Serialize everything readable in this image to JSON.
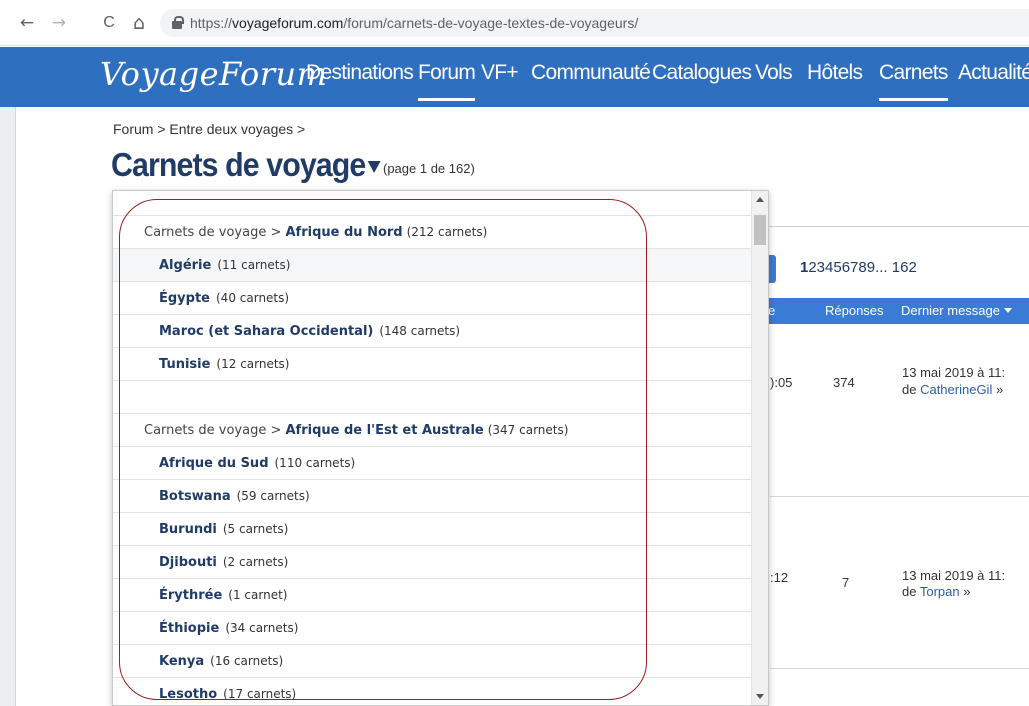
{
  "browser": {
    "back": "←",
    "forward": "→",
    "reload": "C",
    "home": "⌂",
    "url_prefix": "https://",
    "url_domain": "voyageforum.com",
    "url_path": "/forum/carnets-de-voyage-textes-de-voyageurs/"
  },
  "header": {
    "logo": "VoyageForum",
    "nav": [
      "Destinations",
      "Forum",
      "VF+",
      "Communauté",
      "Catalogues",
      "Vols",
      "Hôtels",
      "Carnets",
      "Actualité"
    ],
    "accent": "#2f6fc0"
  },
  "page": {
    "breadcrumb": "Forum > Entre deux voyages >",
    "title": "Carnets de voyage",
    "subtitle": "(page 1 de 162)"
  },
  "pager": {
    "current": "1",
    "pages": "23456789",
    "ellipsis": "...",
    "last": "162"
  },
  "table": {
    "col_fragment": "e",
    "col_reponses": "Réponses",
    "col_dernier": "Dernier message",
    "rows": [
      {
        "time_fragment": "):05",
        "reponses": "374",
        "date": "13 mai 2019 à 11:",
        "by_prefix": "de ",
        "author": "CatherineGil",
        "arrow": " »"
      },
      {
        "time_fragment": ":12",
        "reponses": "7",
        "date": "13 mai 2019 à 11:",
        "by_prefix": "de ",
        "author": "Torpan",
        "arrow": " »"
      }
    ]
  },
  "dropdown": {
    "groups": [
      {
        "prefix": "Carnets de voyage > ",
        "region": "Afrique du Nord",
        "count": "(212 carnets)",
        "items": [
          {
            "name": "Algérie",
            "count": "(11 carnets)"
          },
          {
            "name": "Égypte",
            "count": "(40 carnets)"
          },
          {
            "name": "Maroc (et Sahara Occidental)",
            "count": "(148 carnets)"
          },
          {
            "name": "Tunisie",
            "count": "(12 carnets)"
          }
        ]
      },
      {
        "prefix": "Carnets de voyage > ",
        "region": "Afrique de l'Est et Australe",
        "count": "(347 carnets)",
        "items": [
          {
            "name": "Afrique du Sud",
            "count": "(110 carnets)"
          },
          {
            "name": "Botswana",
            "count": "(59 carnets)"
          },
          {
            "name": "Burundi",
            "count": "(5 carnets)"
          },
          {
            "name": "Djibouti",
            "count": "(2 carnets)"
          },
          {
            "name": "Érythrée",
            "count": "(1 carnet)"
          },
          {
            "name": "Éthiopie",
            "count": "(34 carnets)"
          },
          {
            "name": "Kenya",
            "count": "(16 carnets)"
          },
          {
            "name": "Lesotho",
            "count": "(17 carnets)"
          }
        ]
      }
    ]
  }
}
